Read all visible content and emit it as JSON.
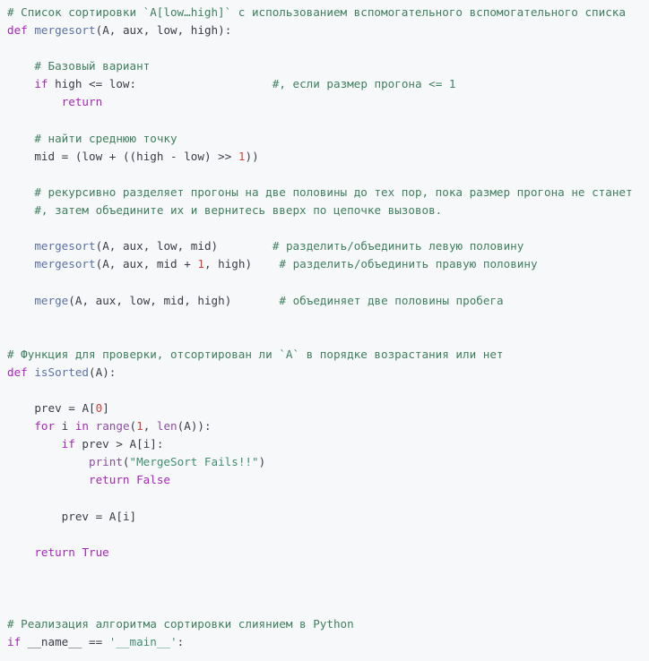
{
  "editor": {
    "language": "Python",
    "background_color": "#f7f8fa",
    "default_text_color": "#3b3b47",
    "font_size_px": 12.6,
    "line_height_px": 20.1
  },
  "theme": {
    "comment_color": "#3f7f5f",
    "keyword_color": "#a626ba",
    "function_name_color": "#5b72a4",
    "builtin_color": "#8a4fa0",
    "string_color": "#3f8f6f",
    "number_color": "#d2413a",
    "operator_color": "#3b3b47"
  },
  "code": {
    "lines": [
      {
        "id": "line-01",
        "tokens": [
          {
            "t": "# Список сортировки `A[low…high]` с использованием вспомогательного вспомогательного списка",
            "c": "c"
          }
        ]
      },
      {
        "id": "line-02",
        "tokens": [
          {
            "t": "def",
            "c": "k"
          },
          {
            "t": " ",
            "c": "o"
          },
          {
            "t": "mergesort",
            "c": "fn"
          },
          {
            "t": "(",
            "c": "p"
          },
          {
            "t": "A",
            "c": "v"
          },
          {
            "t": ", ",
            "c": "p"
          },
          {
            "t": "aux",
            "c": "v"
          },
          {
            "t": ", ",
            "c": "p"
          },
          {
            "t": "low",
            "c": "v"
          },
          {
            "t": ", ",
            "c": "p"
          },
          {
            "t": "high",
            "c": "v"
          },
          {
            "t": "):",
            "c": "p"
          }
        ]
      },
      {
        "id": "line-03",
        "tokens": [
          {
            "t": "",
            "c": "o"
          }
        ]
      },
      {
        "id": "line-04",
        "tokens": [
          {
            "t": "    ",
            "c": "o"
          },
          {
            "t": "# Базовый вариант",
            "c": "c"
          }
        ]
      },
      {
        "id": "line-05",
        "tokens": [
          {
            "t": "    ",
            "c": "o"
          },
          {
            "t": "if",
            "c": "k"
          },
          {
            "t": " high ",
            "c": "v"
          },
          {
            "t": "<=",
            "c": "o"
          },
          {
            "t": " low:",
            "c": "v"
          },
          {
            "t": "                    ",
            "c": "o"
          },
          {
            "t": "#, если размер прогона <= 1",
            "c": "c"
          }
        ]
      },
      {
        "id": "line-06",
        "tokens": [
          {
            "t": "        ",
            "c": "o"
          },
          {
            "t": "return",
            "c": "k"
          }
        ]
      },
      {
        "id": "line-07",
        "tokens": [
          {
            "t": "",
            "c": "o"
          }
        ]
      },
      {
        "id": "line-08",
        "tokens": [
          {
            "t": "    ",
            "c": "o"
          },
          {
            "t": "# найти среднюю точку",
            "c": "c"
          }
        ]
      },
      {
        "id": "line-09",
        "tokens": [
          {
            "t": "    ",
            "c": "o"
          },
          {
            "t": "mid",
            "c": "v"
          },
          {
            "t": " = ",
            "c": "o"
          },
          {
            "t": "(",
            "c": "p"
          },
          {
            "t": "low",
            "c": "v"
          },
          {
            "t": " + ",
            "c": "o"
          },
          {
            "t": "((",
            "c": "p"
          },
          {
            "t": "high",
            "c": "v"
          },
          {
            "t": " - ",
            "c": "o"
          },
          {
            "t": "low",
            "c": "v"
          },
          {
            "t": ") ",
            "c": "p"
          },
          {
            "t": ">>",
            "c": "o"
          },
          {
            "t": " ",
            "c": "o"
          },
          {
            "t": "1",
            "c": "n"
          },
          {
            "t": "))",
            "c": "p"
          }
        ]
      },
      {
        "id": "line-10",
        "tokens": [
          {
            "t": "",
            "c": "o"
          }
        ]
      },
      {
        "id": "line-11",
        "tokens": [
          {
            "t": "    ",
            "c": "o"
          },
          {
            "t": "# рекурсивно разделяет прогоны на две половины до тех пор, пока размер прогона не станет",
            "c": "c"
          }
        ]
      },
      {
        "id": "line-12",
        "tokens": [
          {
            "t": "    ",
            "c": "o"
          },
          {
            "t": "#, затем объедините их и вернитесь вверх по цепочке вызовов.",
            "c": "c"
          }
        ]
      },
      {
        "id": "line-13",
        "tokens": [
          {
            "t": "",
            "c": "o"
          }
        ]
      },
      {
        "id": "line-14",
        "tokens": [
          {
            "t": "    ",
            "c": "o"
          },
          {
            "t": "mergesort",
            "c": "fn"
          },
          {
            "t": "(",
            "c": "p"
          },
          {
            "t": "A",
            "c": "v"
          },
          {
            "t": ", ",
            "c": "p"
          },
          {
            "t": "aux",
            "c": "v"
          },
          {
            "t": ", ",
            "c": "p"
          },
          {
            "t": "low",
            "c": "v"
          },
          {
            "t": ", ",
            "c": "p"
          },
          {
            "t": "mid",
            "c": "v"
          },
          {
            "t": ")",
            "c": "p"
          },
          {
            "t": "        ",
            "c": "o"
          },
          {
            "t": "# разделить/объединить левую половину",
            "c": "c"
          }
        ]
      },
      {
        "id": "line-15",
        "tokens": [
          {
            "t": "    ",
            "c": "o"
          },
          {
            "t": "mergesort",
            "c": "fn"
          },
          {
            "t": "(",
            "c": "p"
          },
          {
            "t": "A",
            "c": "v"
          },
          {
            "t": ", ",
            "c": "p"
          },
          {
            "t": "aux",
            "c": "v"
          },
          {
            "t": ", ",
            "c": "p"
          },
          {
            "t": "mid",
            "c": "v"
          },
          {
            "t": " + ",
            "c": "o"
          },
          {
            "t": "1",
            "c": "n"
          },
          {
            "t": ", ",
            "c": "p"
          },
          {
            "t": "high",
            "c": "v"
          },
          {
            "t": ")",
            "c": "p"
          },
          {
            "t": "    ",
            "c": "o"
          },
          {
            "t": "# разделить/объединить правую половину",
            "c": "c"
          }
        ]
      },
      {
        "id": "line-16",
        "tokens": [
          {
            "t": "",
            "c": "o"
          }
        ]
      },
      {
        "id": "line-17",
        "tokens": [
          {
            "t": "    ",
            "c": "o"
          },
          {
            "t": "merge",
            "c": "fn"
          },
          {
            "t": "(",
            "c": "p"
          },
          {
            "t": "A",
            "c": "v"
          },
          {
            "t": ", ",
            "c": "p"
          },
          {
            "t": "aux",
            "c": "v"
          },
          {
            "t": ", ",
            "c": "p"
          },
          {
            "t": "low",
            "c": "v"
          },
          {
            "t": ", ",
            "c": "p"
          },
          {
            "t": "mid",
            "c": "v"
          },
          {
            "t": ", ",
            "c": "p"
          },
          {
            "t": "high",
            "c": "v"
          },
          {
            "t": ")",
            "c": "p"
          },
          {
            "t": "       ",
            "c": "o"
          },
          {
            "t": "# объединяет две половины пробега",
            "c": "c"
          }
        ]
      },
      {
        "id": "line-18",
        "tokens": [
          {
            "t": "",
            "c": "o"
          }
        ]
      },
      {
        "id": "line-19",
        "tokens": [
          {
            "t": "",
            "c": "o"
          }
        ]
      },
      {
        "id": "line-20",
        "tokens": [
          {
            "t": "# Функция для проверки, отсортирован ли `A` в порядке возрастания или нет",
            "c": "c"
          }
        ]
      },
      {
        "id": "line-21",
        "tokens": [
          {
            "t": "def",
            "c": "k"
          },
          {
            "t": " ",
            "c": "o"
          },
          {
            "t": "isSorted",
            "c": "fn"
          },
          {
            "t": "(",
            "c": "p"
          },
          {
            "t": "A",
            "c": "v"
          },
          {
            "t": "):",
            "c": "p"
          }
        ]
      },
      {
        "id": "line-22",
        "tokens": [
          {
            "t": "",
            "c": "o"
          }
        ]
      },
      {
        "id": "line-23",
        "tokens": [
          {
            "t": "    ",
            "c": "o"
          },
          {
            "t": "prev",
            "c": "v"
          },
          {
            "t": " = ",
            "c": "o"
          },
          {
            "t": "A",
            "c": "v"
          },
          {
            "t": "[",
            "c": "p"
          },
          {
            "t": "0",
            "c": "n"
          },
          {
            "t": "]",
            "c": "p"
          }
        ]
      },
      {
        "id": "line-24",
        "tokens": [
          {
            "t": "    ",
            "c": "o"
          },
          {
            "t": "for",
            "c": "k"
          },
          {
            "t": " i ",
            "c": "v"
          },
          {
            "t": "in",
            "c": "k"
          },
          {
            "t": " ",
            "c": "o"
          },
          {
            "t": "range",
            "c": "bi"
          },
          {
            "t": "(",
            "c": "p"
          },
          {
            "t": "1",
            "c": "n"
          },
          {
            "t": ", ",
            "c": "p"
          },
          {
            "t": "len",
            "c": "bi"
          },
          {
            "t": "(",
            "c": "p"
          },
          {
            "t": "A",
            "c": "v"
          },
          {
            "t": ")):",
            "c": "p"
          }
        ]
      },
      {
        "id": "line-25",
        "tokens": [
          {
            "t": "        ",
            "c": "o"
          },
          {
            "t": "if",
            "c": "k"
          },
          {
            "t": " prev ",
            "c": "v"
          },
          {
            "t": ">",
            "c": "o"
          },
          {
            "t": " A",
            "c": "v"
          },
          {
            "t": "[",
            "c": "p"
          },
          {
            "t": "i",
            "c": "v"
          },
          {
            "t": "]:",
            "c": "p"
          }
        ]
      },
      {
        "id": "line-26",
        "tokens": [
          {
            "t": "            ",
            "c": "o"
          },
          {
            "t": "print",
            "c": "bi"
          },
          {
            "t": "(",
            "c": "p"
          },
          {
            "t": "\"MergeSort Fails!!\"",
            "c": "s"
          },
          {
            "t": ")",
            "c": "p"
          }
        ]
      },
      {
        "id": "line-27",
        "tokens": [
          {
            "t": "            ",
            "c": "o"
          },
          {
            "t": "return",
            "c": "k"
          },
          {
            "t": " ",
            "c": "o"
          },
          {
            "t": "False",
            "c": "kc"
          }
        ]
      },
      {
        "id": "line-28",
        "tokens": [
          {
            "t": "",
            "c": "o"
          }
        ]
      },
      {
        "id": "line-29",
        "tokens": [
          {
            "t": "        ",
            "c": "o"
          },
          {
            "t": "prev",
            "c": "v"
          },
          {
            "t": " = ",
            "c": "o"
          },
          {
            "t": "A",
            "c": "v"
          },
          {
            "t": "[",
            "c": "p"
          },
          {
            "t": "i",
            "c": "v"
          },
          {
            "t": "]",
            "c": "p"
          }
        ]
      },
      {
        "id": "line-30",
        "tokens": [
          {
            "t": "",
            "c": "o"
          }
        ]
      },
      {
        "id": "line-31",
        "tokens": [
          {
            "t": "    ",
            "c": "o"
          },
          {
            "t": "return",
            "c": "k"
          },
          {
            "t": " ",
            "c": "o"
          },
          {
            "t": "True",
            "c": "kc"
          }
        ]
      },
      {
        "id": "line-32",
        "tokens": [
          {
            "t": "",
            "c": "o"
          }
        ]
      },
      {
        "id": "line-33",
        "tokens": [
          {
            "t": "",
            "c": "o"
          }
        ]
      },
      {
        "id": "line-34",
        "tokens": [
          {
            "t": "",
            "c": "o"
          }
        ]
      },
      {
        "id": "line-35",
        "tokens": [
          {
            "t": "# Реализация алгоритма сортировки слиянием в Python",
            "c": "c"
          }
        ]
      },
      {
        "id": "line-36",
        "tokens": [
          {
            "t": "if",
            "c": "k"
          },
          {
            "t": " __name__ ",
            "c": "v"
          },
          {
            "t": "==",
            "c": "o"
          },
          {
            "t": " ",
            "c": "o"
          },
          {
            "t": "'__main__'",
            "c": "s"
          },
          {
            "t": ":",
            "c": "p"
          }
        ]
      }
    ]
  }
}
